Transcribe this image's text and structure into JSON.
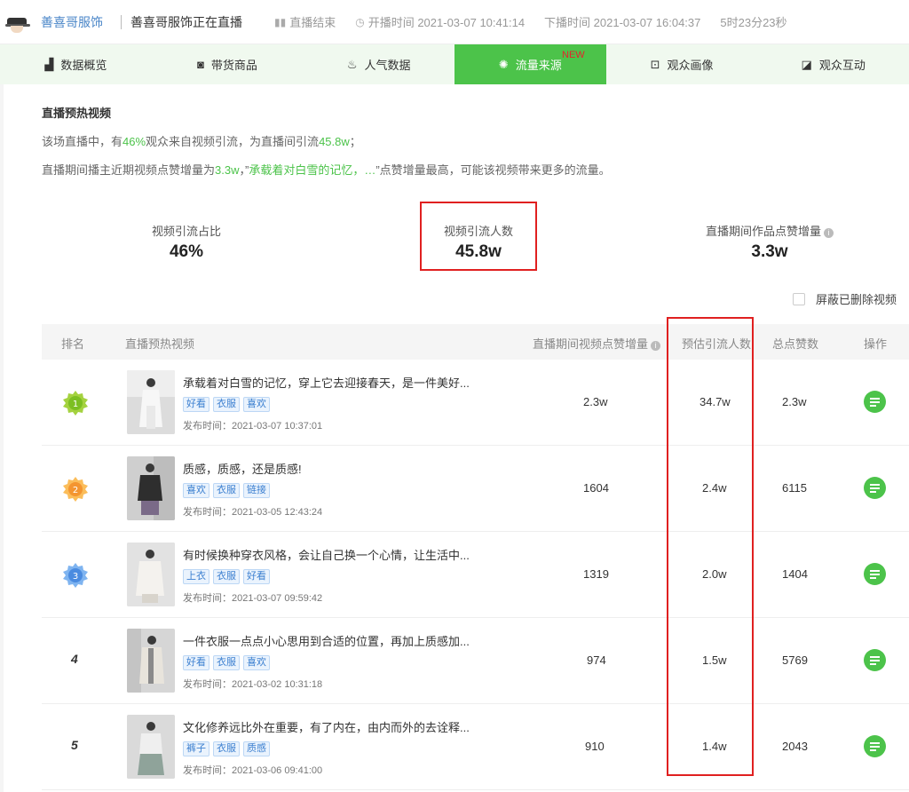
{
  "header": {
    "brand": "善喜哥服饰",
    "live_title": "善喜哥服饰正在直播",
    "status": "直播结束",
    "start_label": "开播时间 2021-03-07 10:41:14",
    "end_label": "下播时间 2021-03-07 16:04:37",
    "duration": "5时23分23秒"
  },
  "tabs": [
    {
      "label": "数据概览",
      "icon": "bar-chart-icon"
    },
    {
      "label": "带货商品",
      "icon": "shopping-bag-icon"
    },
    {
      "label": "人气数据",
      "icon": "flame-icon"
    },
    {
      "label": "流量来源",
      "icon": "traffic-icon",
      "badge": "NEW",
      "active": true
    },
    {
      "label": "观众画像",
      "icon": "portrait-icon"
    },
    {
      "label": "观众互动",
      "icon": "interaction-icon"
    }
  ],
  "section": {
    "title": "直播预热视频",
    "line1": [
      "该场直播中，有",
      "46%",
      "观众来自视频引流，为直播间引流",
      "45.8w",
      "；"
    ],
    "line2": [
      "直播期间播主近期视频点赞增量为",
      "3.3w",
      "，”",
      "承载着对白雪的记忆，…",
      "”点赞增量最高，可能该视频带来更多的流量。"
    ]
  },
  "stats": [
    {
      "label": "视频引流占比",
      "value": "46%"
    },
    {
      "label": "视频引流人数",
      "value": "45.8w"
    },
    {
      "label": "直播期间作品点赞增量",
      "value": "3.3w",
      "info": "i"
    }
  ],
  "hide_deleted_label": "屏蔽已删除视频",
  "table": {
    "headers": [
      "排名",
      "直播预热视频",
      "直播期间视频点赞增量",
      "预估引流人数",
      "总点赞数",
      "操作"
    ],
    "header_info": "i",
    "pub_prefix": "发布时间：",
    "rows": [
      {
        "rank": "1",
        "title": "承载着对白雪的记忆，穿上它去迎接春天，是一件美好...",
        "tags": [
          "好看",
          "衣服",
          "喜欢"
        ],
        "published": "2021-03-07 10:37:01",
        "likes_inc": "2.3w",
        "est_traffic": "34.7w",
        "total_likes": "2.3w"
      },
      {
        "rank": "2",
        "title": "质感，质感，还是质感!",
        "tags": [
          "喜欢",
          "衣服",
          "链接"
        ],
        "published": "2021-03-05 12:43:24",
        "likes_inc": "1604",
        "est_traffic": "2.4w",
        "total_likes": "6115"
      },
      {
        "rank": "3",
        "title": "有时候换种穿衣风格，会让自己换一个心情，让生活中...",
        "tags": [
          "上衣",
          "衣服",
          "好看"
        ],
        "published": "2021-03-07 09:59:42",
        "likes_inc": "1319",
        "est_traffic": "2.0w",
        "total_likes": "1404"
      },
      {
        "rank": "4",
        "title": "一件衣服一点点小心思用到合适的位置，再加上质感加...",
        "tags": [
          "好看",
          "衣服",
          "喜欢"
        ],
        "published": "2021-03-02 10:31:18",
        "likes_inc": "974",
        "est_traffic": "1.5w",
        "total_likes": "5769"
      },
      {
        "rank": "5",
        "title": "文化修养远比外在重要，有了内在，由内而外的去诠释...",
        "tags": [
          "裤子",
          "衣服",
          "质感"
        ],
        "published": "2021-03-06 09:41:00",
        "likes_inc": "910",
        "est_traffic": "1.4w",
        "total_likes": "2043"
      }
    ]
  },
  "colors": {
    "accent": "#4cc34a",
    "highlight": "#e02020",
    "brand_blue": "#4a86c8",
    "tag_blue": "#3b7fd0"
  }
}
